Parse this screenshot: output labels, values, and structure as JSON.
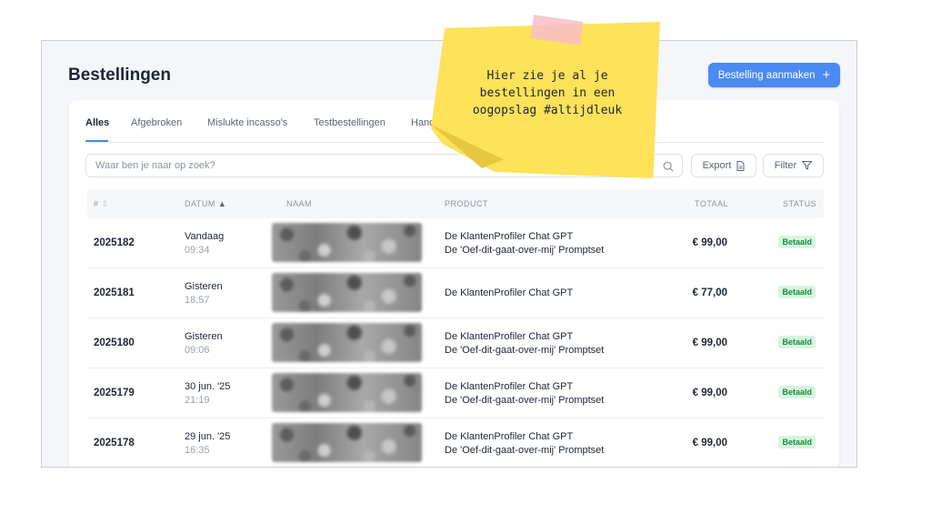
{
  "header": {
    "title": "Bestellingen",
    "create_button_label": "Bestelling aanmaken",
    "create_button_icon": "plus-icon"
  },
  "tabs": [
    {
      "label": "Alles",
      "active": true
    },
    {
      "label": "Afgebroken"
    },
    {
      "label": "Mislukte incasso's"
    },
    {
      "label": "Testbestellingen"
    },
    {
      "label": "Hand"
    }
  ],
  "toolbar": {
    "search_placeholder": "Waar ben je naar op zoek?",
    "export_label": "Export",
    "filter_label": "Filter"
  },
  "table": {
    "columns": {
      "id": "#",
      "date": "DATUM",
      "name": "NAAM",
      "product": "PRODUCT",
      "total": "TOTAAL",
      "status": "STATUS"
    },
    "rows": [
      {
        "id": "2025182",
        "date": "Vandaag",
        "time": "09:34",
        "products": [
          "De KlantenProfiler Chat GPT",
          "De 'Oef-dit-gaat-over-mij' Promptset"
        ],
        "total": "€ 99,00",
        "status": "Betaald"
      },
      {
        "id": "2025181",
        "date": "Gisteren",
        "time": "18:57",
        "products": [
          "De KlantenProfiler Chat GPT"
        ],
        "total": "€ 77,00",
        "status": "Betaald"
      },
      {
        "id": "2025180",
        "date": "Gisteren",
        "time": "09:06",
        "products": [
          "De KlantenProfiler Chat GPT",
          "De 'Oef-dit-gaat-over-mij' Promptset"
        ],
        "total": "€ 99,00",
        "status": "Betaald"
      },
      {
        "id": "2025179",
        "date": "30 jun. '25",
        "time": "21:19",
        "products": [
          "De KlantenProfiler Chat GPT",
          "De 'Oef-dit-gaat-over-mij' Promptset"
        ],
        "total": "€ 99,00",
        "status": "Betaald"
      },
      {
        "id": "2025178",
        "date": "29 jun. '25",
        "time": "16:35",
        "products": [
          "De KlantenProfiler Chat GPT",
          "De 'Oef-dit-gaat-over-mij' Promptset"
        ],
        "total": "€ 99,00",
        "status": "Betaald"
      }
    ]
  },
  "sticky_note": {
    "lines": [
      "Hier zie je al je",
      "bestellingen in een",
      "oogopslag #altijdleuk"
    ]
  },
  "colors": {
    "accent": "#4a8af4",
    "paid_badge_bg": "#d6f5de",
    "paid_badge_text": "#1c8a44",
    "sticky_note": "#fde25a"
  }
}
